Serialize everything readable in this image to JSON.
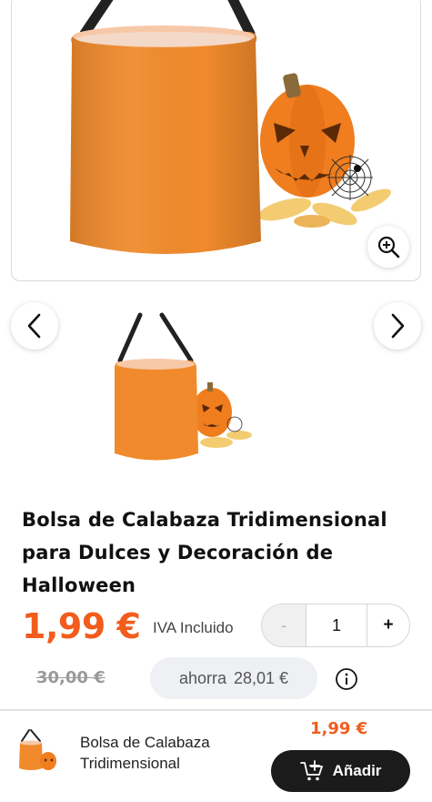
{
  "product": {
    "title": "Bolsa de Calabaza Tridimensional para Dulces y Decoración de Halloween",
    "price": "1,99 €",
    "vat_label": "IVA Incluido",
    "old_price": "30,00 €",
    "savings_label": "ahorra",
    "savings_value": "28,01 €"
  },
  "quantity": {
    "minus": "-",
    "value": "1",
    "plus": "+"
  },
  "gallery": {
    "main_image_icon": "orange-bag-with-pumpkin-image",
    "zoom_icon": "zoom-in-icon",
    "prev_icon": "chevron-left-icon",
    "next_icon": "chevron-right-icon"
  },
  "footer": {
    "title": "Bolsa de Calabaza Tridimensional",
    "price": "1,99 €",
    "add_label": "Añadir",
    "cart_icon": "cart-plus-icon"
  },
  "colors": {
    "accent": "#f25c1c",
    "bag": "#f08a2c",
    "button_dark": "#1b1b1b"
  }
}
